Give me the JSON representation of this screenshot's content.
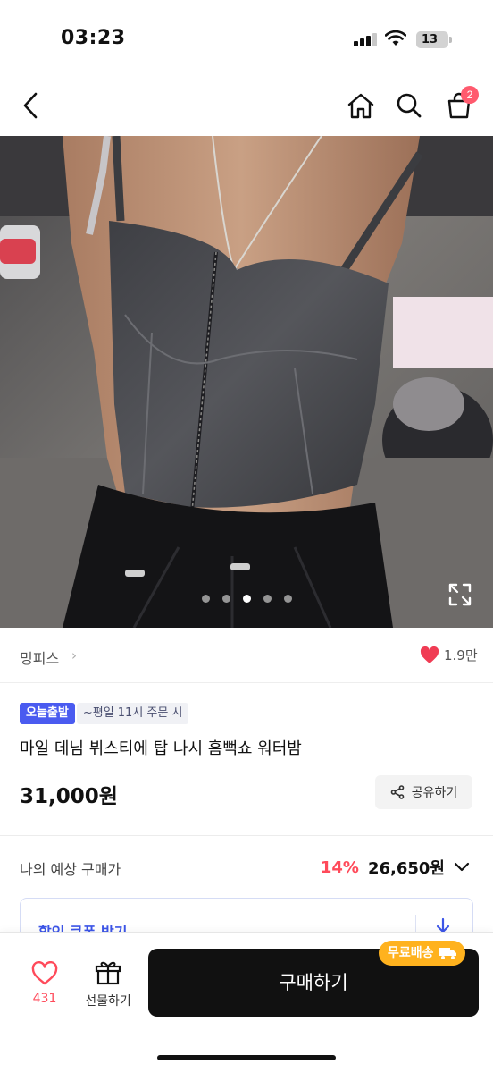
{
  "status": {
    "time": "03:23",
    "battery": "13"
  },
  "nav": {
    "cart_count": "2",
    "icons": [
      "back-icon",
      "home-icon",
      "search-icon",
      "cart-icon"
    ]
  },
  "gallery": {
    "total_images": 5,
    "active_index": 2
  },
  "brand": {
    "name": "밍피스",
    "chevron": "›",
    "likes": "1.9만"
  },
  "tags": {
    "badge": "오늘출발",
    "note": "~평일 11시 주문 시"
  },
  "product": {
    "title": "마일 데님 뷔스티에 탑 나시 흠뻑쇼 워터밤",
    "price": "31,000원"
  },
  "share": {
    "label": "공유하기"
  },
  "estimate": {
    "label": "나의 예상 구매가",
    "discount": "14%",
    "price": "26,650원"
  },
  "coupon": {
    "label": "할인 쿠폰 받기"
  },
  "bottom": {
    "like_count": "431",
    "gift_label": "선물하기",
    "buy_label": "구매하기",
    "shipping_badge": "무료배송"
  },
  "colors": {
    "accent_pink": "#ff4a5a",
    "badge_blue": "#4a5bf0",
    "shipping_orange": "#ffb21e",
    "buy_black": "#111111"
  }
}
